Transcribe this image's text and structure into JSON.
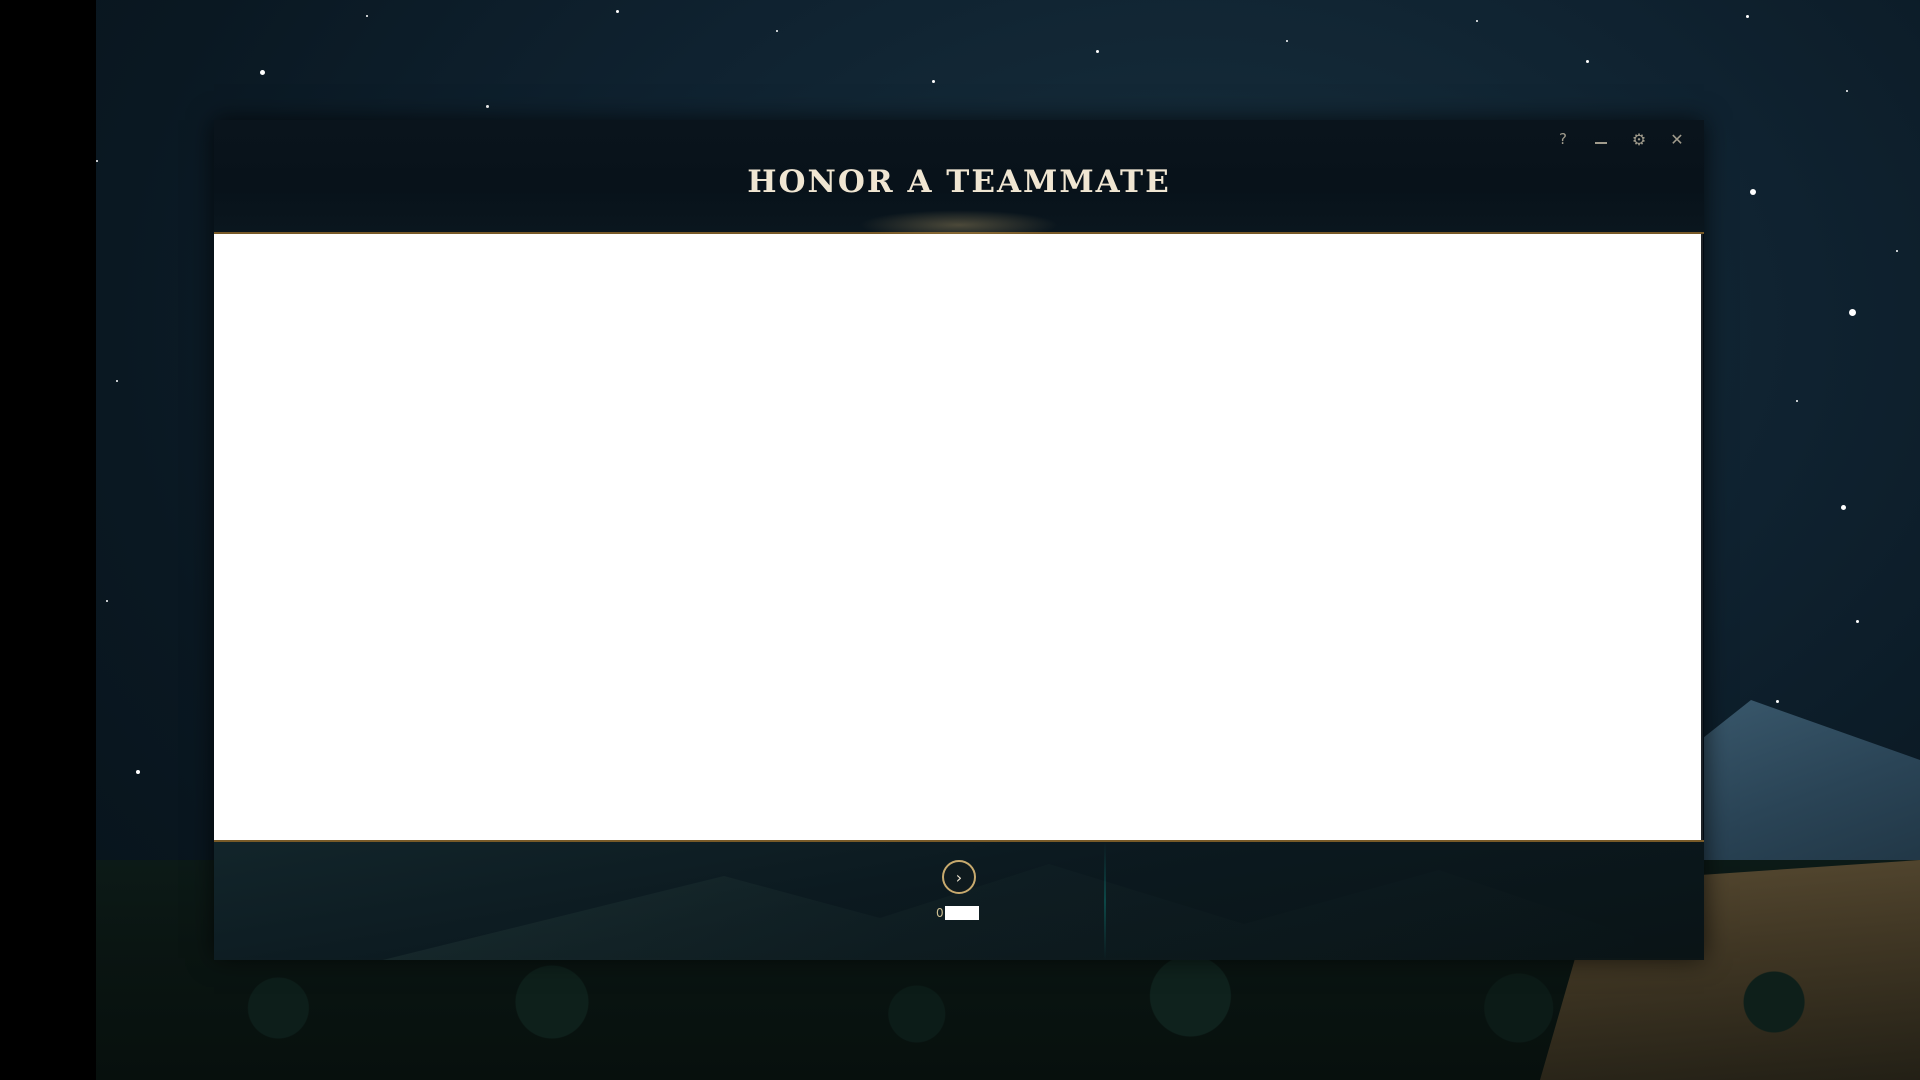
{
  "modal": {
    "title": "HONOR A TEAMMATE",
    "controls": {
      "help": "?",
      "settings": "⚙",
      "close": "✕"
    },
    "footer": {
      "next_symbol": "›",
      "counter_text": "0"
    }
  },
  "icons": {
    "help": "help-icon",
    "minimize": "minimize-icon",
    "settings": "gear-icon",
    "close": "close-icon",
    "next": "chevron-right-icon"
  },
  "colors": {
    "title": "#f0e6d2",
    "gold_border": "#785a28",
    "gold_accent": "#c8aa6e",
    "modal_bg": "#010a13",
    "content_bg": "#ffffff"
  }
}
